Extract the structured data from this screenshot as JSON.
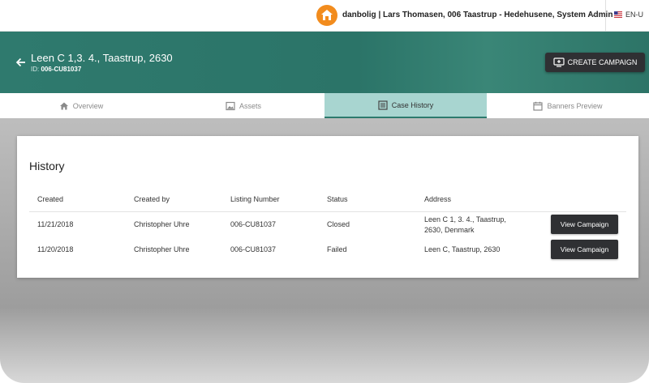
{
  "topbar": {
    "user_label": "danbolig | Lars Thomasen, 006 Taastrup - Hedehusene, System Admin",
    "language": "EN-U"
  },
  "header": {
    "title": "Leen C 1,3. 4., Taastrup, 2630",
    "id_prefix": "ID:",
    "id_value": "006-CU81037",
    "create_button": "CREATE CAMPAIGN"
  },
  "tabs": [
    {
      "label": "Overview",
      "icon": "home-icon",
      "active": false
    },
    {
      "label": "Assets",
      "icon": "image-icon",
      "active": false
    },
    {
      "label": "Case History",
      "icon": "list-icon",
      "active": true
    },
    {
      "label": "Banners Preview",
      "icon": "calendar-icon",
      "active": false
    }
  ],
  "history": {
    "title": "History",
    "columns": [
      "Created",
      "Created by",
      "Listing Number",
      "Status",
      "Address"
    ],
    "rows": [
      {
        "created": "11/21/2018",
        "created_by": "Christopher Uhre",
        "listing_number": "006-CU81037",
        "status": "Closed",
        "address_line1": "Leen C 1, 3. 4., Taastrup,",
        "address_line2": "2630, Denmark",
        "action": "View Campaign"
      },
      {
        "created": "11/20/2018",
        "created_by": "Christopher Uhre",
        "listing_number": "006-CU81037",
        "status": "Failed",
        "address_line1": "Leen C, Taastrup, 2630",
        "address_line2": "",
        "action": "View Campaign"
      }
    ]
  },
  "colors": {
    "header_teal": "#2b7468",
    "active_tab": "#a8d5d0",
    "brand_orange": "#f28c1e",
    "dark_button": "#2f3033"
  }
}
